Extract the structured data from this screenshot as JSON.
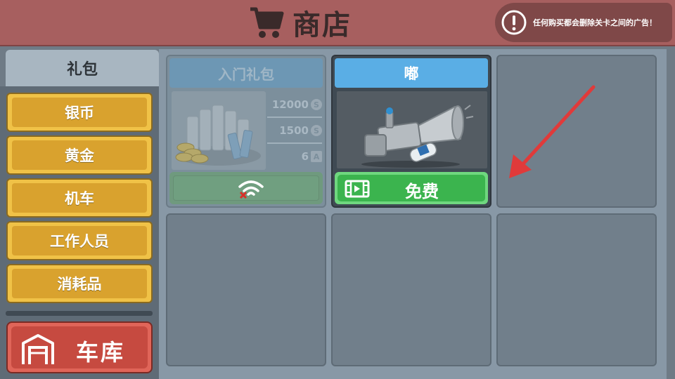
{
  "header": {
    "title": "商店",
    "notice": "任何购买都会删除关卡之间的广告！"
  },
  "sidebar": {
    "tab_label": "礼包",
    "categories": [
      "银币",
      "黄金",
      "机车",
      "工作人员",
      "消耗品"
    ],
    "garage_label": "车库"
  },
  "cards": [
    {
      "title": "入门礼包",
      "stats": [
        "12000",
        "1500",
        "6"
      ],
      "stat_icons": [
        "S",
        "S",
        "A"
      ],
      "action_icon": "wifi-off-icon"
    },
    {
      "title": "嘟",
      "action_label": "免费",
      "action_icon": "video-icon"
    }
  ],
  "colors": {
    "header_bg": "#a75f5f",
    "gold_button": "#d9a22e",
    "garage_button": "#c64a40",
    "free_button": "#3bb44e",
    "card_title_blue": "#5aaee5"
  }
}
